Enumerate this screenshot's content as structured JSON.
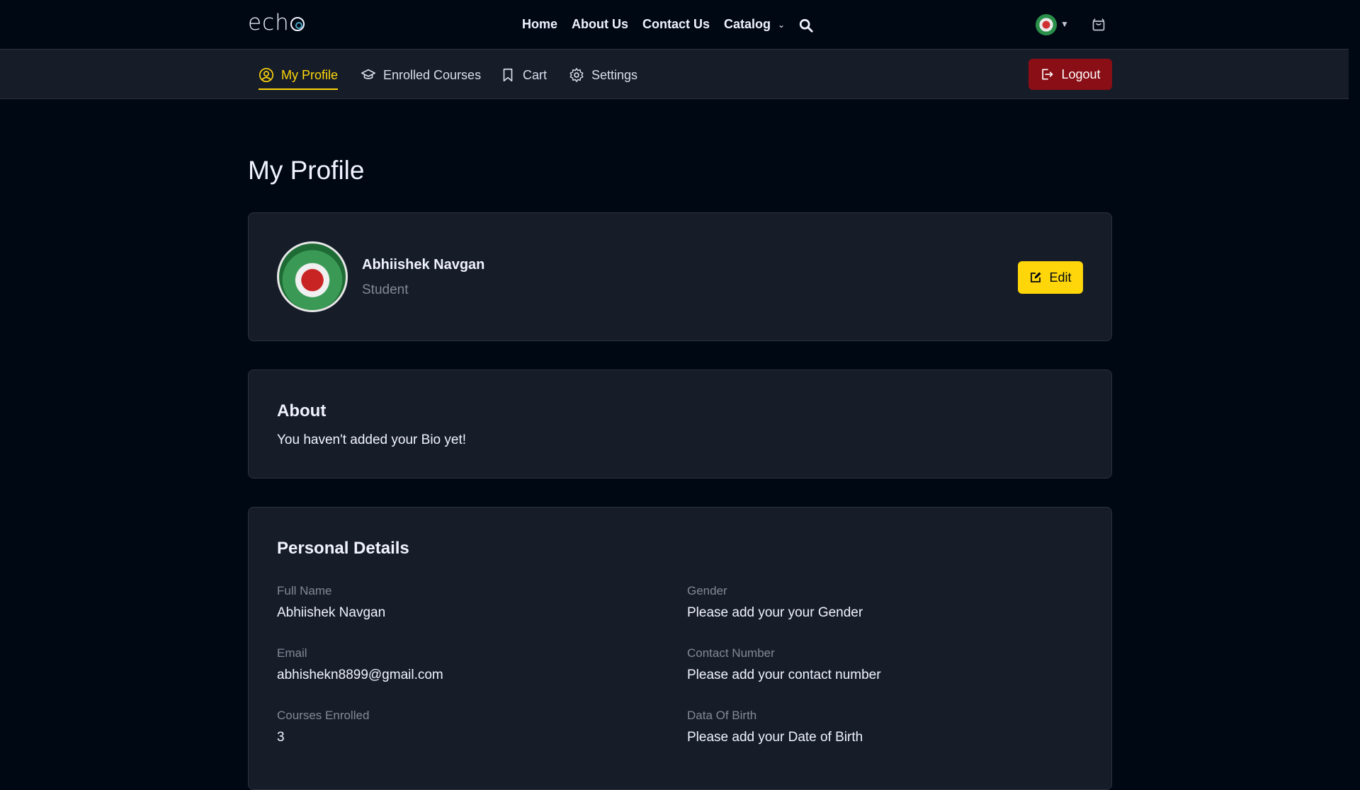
{
  "topnav": {
    "logo": "ech",
    "links": [
      "Home",
      "About Us",
      "Contact Us"
    ],
    "catalog_label": "Catalog"
  },
  "subnav": {
    "items": [
      {
        "label": "My Profile",
        "icon": "user-circle-icon",
        "active": true
      },
      {
        "label": "Enrolled Courses",
        "icon": "graduation-cap-icon",
        "active": false
      },
      {
        "label": "Cart",
        "icon": "bookmark-icon",
        "active": false
      },
      {
        "label": "Settings",
        "icon": "gear-icon",
        "active": false
      }
    ],
    "logout_label": "Logout"
  },
  "page": {
    "title": "My Profile"
  },
  "profile": {
    "name": "Abhiishek Navgan",
    "role": "Student",
    "edit_label": "Edit"
  },
  "about": {
    "title": "About",
    "text": "You haven't added your Bio yet!"
  },
  "details": {
    "title": "Personal Details",
    "fields": [
      {
        "label": "Full Name",
        "value": "Abhiishek Navgan"
      },
      {
        "label": "Gender",
        "value": "Please add your your Gender"
      },
      {
        "label": "Email",
        "value": "abhishekn8899@gmail.com"
      },
      {
        "label": "Contact Number",
        "value": "Please add your contact number"
      },
      {
        "label": "Courses Enrolled",
        "value": "3"
      },
      {
        "label": "Data Of Birth",
        "value": "Please add your Date of Birth"
      }
    ]
  },
  "colors": {
    "background": "#000814",
    "card": "#161d29",
    "accent": "#ffd60a",
    "logout": "#8a0e15"
  }
}
